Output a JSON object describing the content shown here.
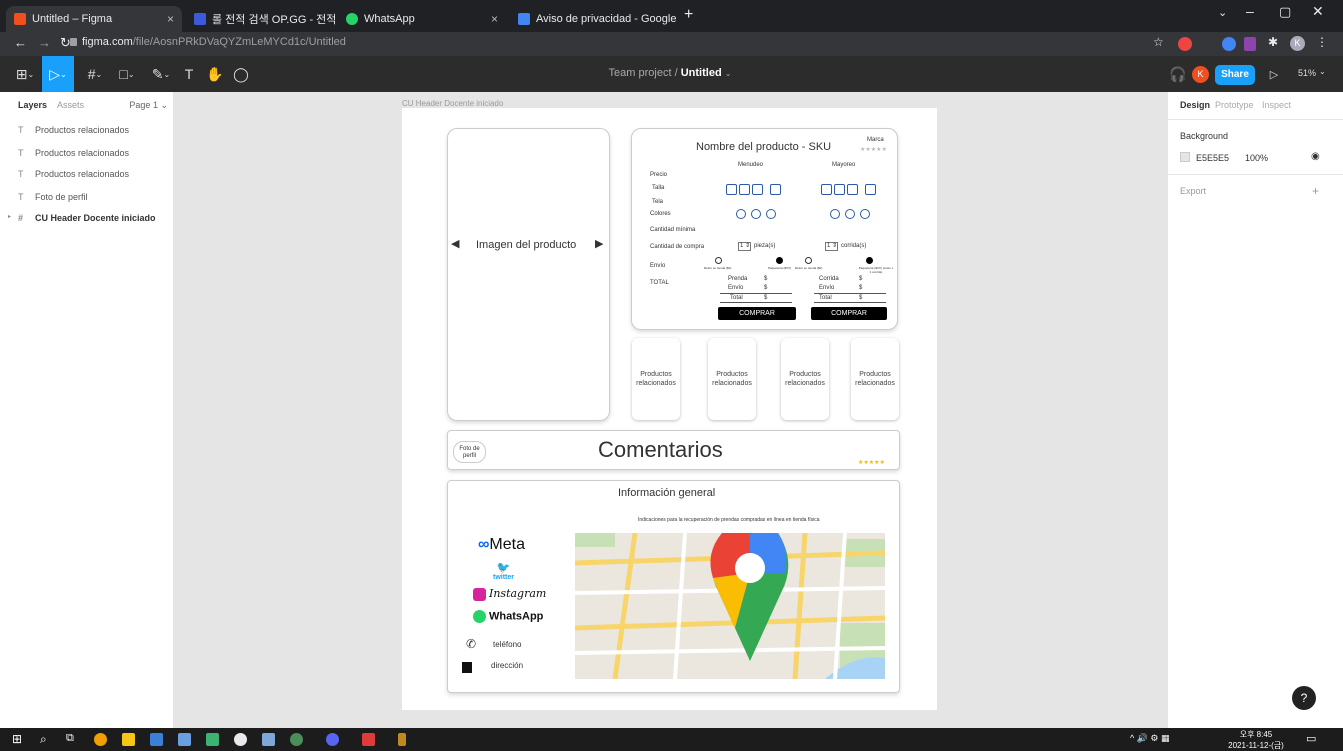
{
  "browser": {
    "tabs": [
      {
        "title": "Untitled – Figma",
        "color": "#f24e1e"
      },
      {
        "title": "롤 전적 검색 OP.GG - 전적 검색 ×",
        "color": "#3b5bdb"
      },
      {
        "title": "WhatsApp",
        "color": "#25d366"
      },
      {
        "title": "Aviso de privacidad - Google D",
        "color": "#4285f4"
      }
    ],
    "url_host": "figma.com",
    "url_path": "/file/AosnPRkDVaQYZmLeMYCd1c/Untitled",
    "new_tab": "+"
  },
  "figma": {
    "project": "Team project",
    "separator": "/",
    "file": "Untitled",
    "share": "Share",
    "zoom": "51%",
    "avatar": "K"
  },
  "left_panel": {
    "tabs": [
      "Layers",
      "Assets"
    ],
    "page": "Page 1",
    "layers": [
      {
        "icon": "T",
        "name": "Productos relacionados"
      },
      {
        "icon": "T",
        "name": "Productos relacionados"
      },
      {
        "icon": "T",
        "name": "Productos relacionados"
      },
      {
        "icon": "T",
        "name": "Foto de perfil"
      },
      {
        "icon": "#",
        "name": "CU Header Docente iniciado"
      }
    ]
  },
  "right_panel": {
    "tabs": [
      "Design",
      "Prototype",
      "Inspect"
    ],
    "background_label": "Background",
    "bg_hex": "E5E5E5",
    "bg_opacity": "100%",
    "export_label": "Export",
    "help": "?"
  },
  "canvas": {
    "frame_label": "CU Header Docente iniciado",
    "image_placeholder": "Imagen del producto",
    "product_title": "Nombre del producto - SKU",
    "brand": "Marca",
    "stars": "★★★★★",
    "col_retail": "Menudeo",
    "col_wholesale": "Mayoreo",
    "rows": [
      "Precio",
      "Talla",
      "Tela",
      "Colores",
      "Cantidad mínima",
      "Cantidad de compra",
      "Envío",
      "TOTAL"
    ],
    "qty_value": "1",
    "qty_retail_unit": "pieza(s)",
    "qty_wholesale_unit": "corrida(s)",
    "ship_opts": [
      "Retiro en tienda ($0)",
      "Paquetería ($XX)"
    ],
    "ship_opts_wholesale": [
      "Retiro en tienda ($0)",
      "Paquetería ($XX) (costo x 1 corrida)"
    ],
    "totals_retail": [
      [
        "Prenda",
        "$"
      ],
      [
        "Envío",
        "$"
      ],
      [
        "Total",
        "$"
      ]
    ],
    "totals_wholesale": [
      [
        "Corrida",
        "$"
      ],
      [
        "Envío",
        "$"
      ],
      [
        "Total",
        "$"
      ]
    ],
    "buy_label": "COMPRAR",
    "related": [
      "Productos relacionados",
      "Productos relacionados",
      "Productos relacionados",
      "Productos relacionados"
    ],
    "profile_photo": "Foto de perfil",
    "comments_title": "Comentarios",
    "comments_stars": "★★★★★",
    "info_title": "Información general",
    "info_sub": "Indicaciones para la recuperación de prendas compradas en línea en tienda física",
    "social": [
      "Meta",
      "twitter",
      "Instagram",
      "WhatsApp"
    ],
    "phone": "teléfono",
    "address": "dirección"
  },
  "taskbar": {
    "time": "오후 8:45",
    "date": "2021-11-12-(금)"
  }
}
